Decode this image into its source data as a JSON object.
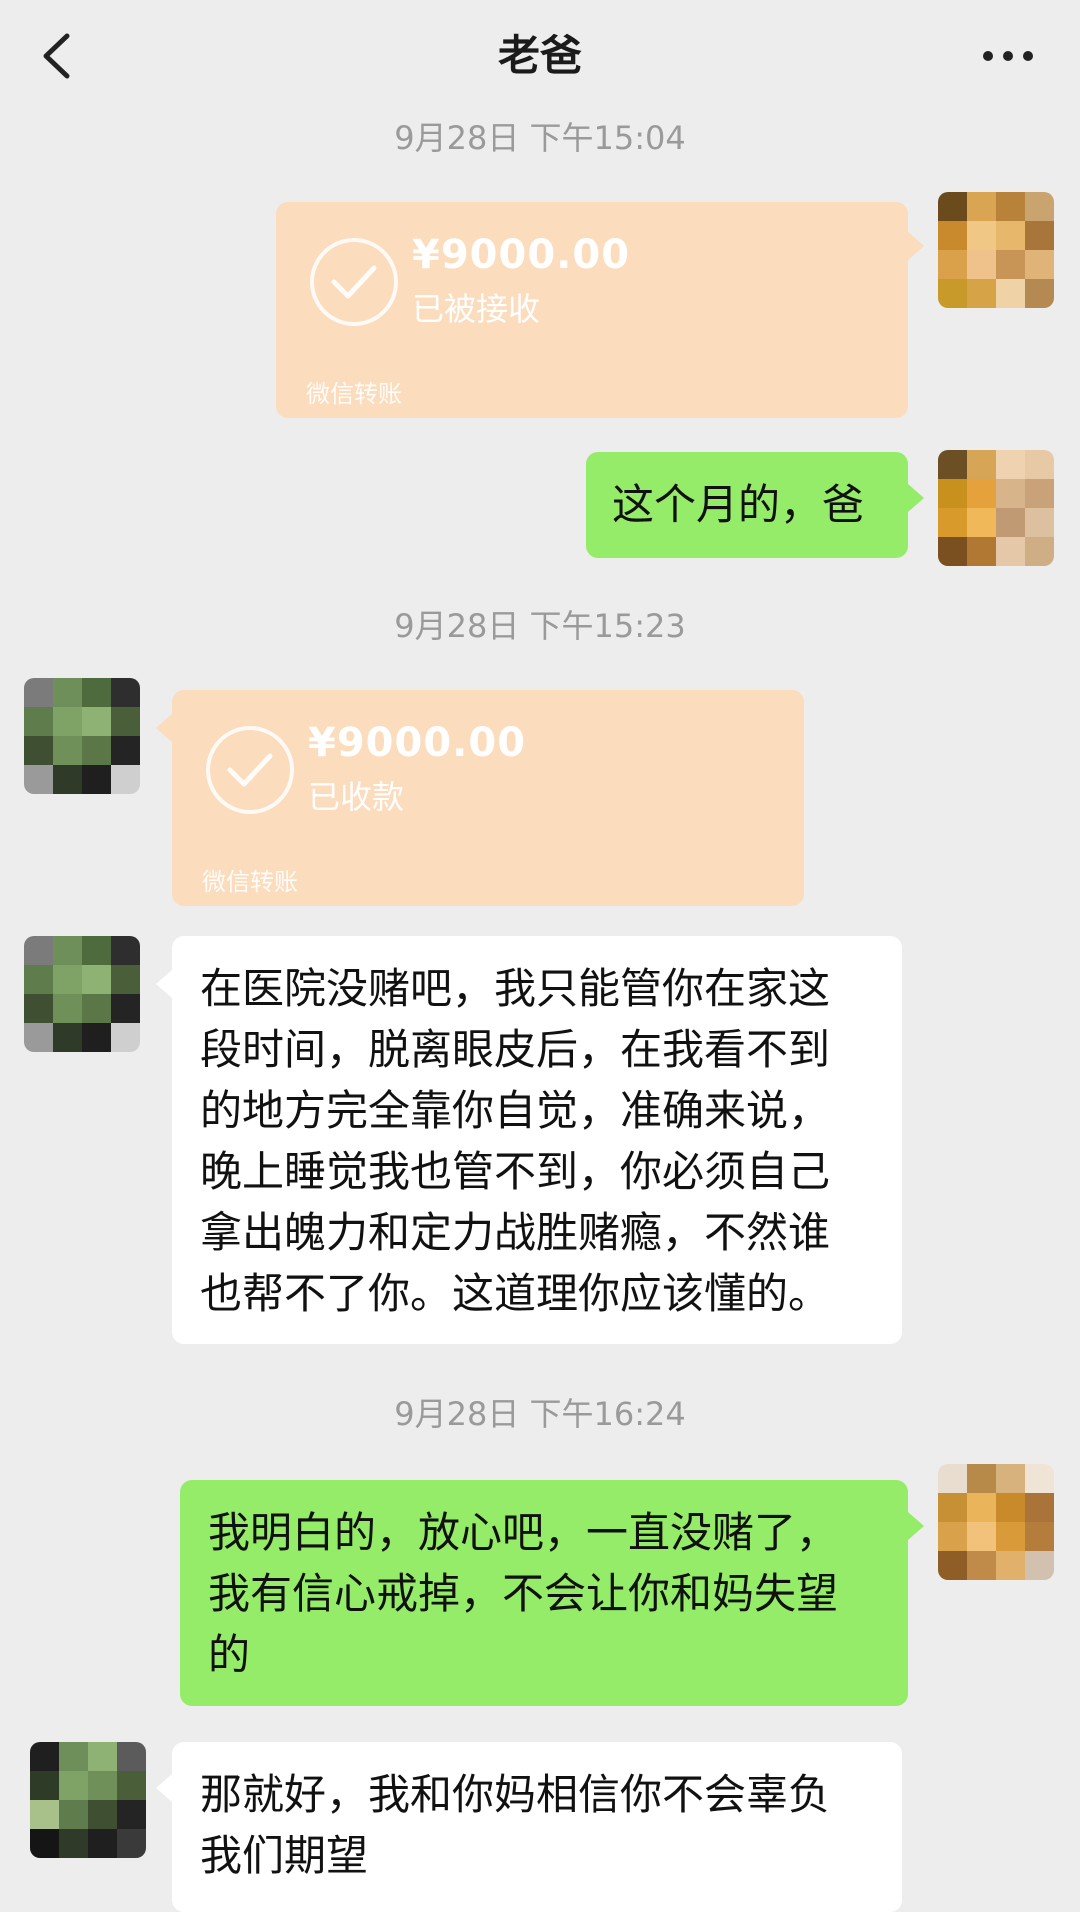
{
  "header": {
    "title": "老爸",
    "back_icon": "chevron-left-icon",
    "more_icon": "more-dots-icon"
  },
  "colors": {
    "bg": "#ededed",
    "self_bubble": "#95ec69",
    "other_bubble": "#ffffff",
    "transfer_card": "#fbdcbd"
  },
  "messages": [
    {
      "type": "timestamp",
      "text": "9月28日 下午15:04"
    },
    {
      "type": "transfer",
      "side": "right",
      "amount": "¥9000.00",
      "status": "已被接收",
      "footer": "微信转账"
    },
    {
      "type": "text",
      "side": "right",
      "text": "这个月的，爸"
    },
    {
      "type": "timestamp",
      "text": "9月28日 下午15:23"
    },
    {
      "type": "transfer",
      "side": "left",
      "amount": "¥9000.00",
      "status": "已收款",
      "footer": "微信转账"
    },
    {
      "type": "text",
      "side": "left",
      "lines": [
        "在医院没赌吧，我只能管你在家这",
        "段时间，脱离眼皮后，在我看不到",
        "的地方完全靠你自觉，准确来说，",
        "晚上睡觉我也管不到，你必须自己",
        "拿出魄力和定力战胜赌瘾，不然谁",
        "也帮不了你。这道理你应该懂的。"
      ]
    },
    {
      "type": "timestamp",
      "text": "9月28日 下午16:24"
    },
    {
      "type": "text",
      "side": "right",
      "lines": [
        "我明白的，放心吧，一直没赌了，",
        "我有信心戒掉，不会让你和妈失望",
        "的"
      ]
    },
    {
      "type": "text",
      "side": "left",
      "lines": [
        "那就好，我和你妈相信你不会辜负",
        "我们期望"
      ]
    }
  ]
}
